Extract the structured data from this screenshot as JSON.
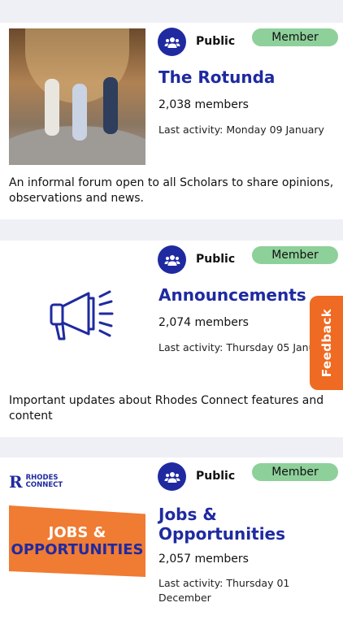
{
  "groups": [
    {
      "privacy": "Public",
      "badge": "Member",
      "title": "The Rotunda",
      "members": "2,038 members",
      "last_activity": "Last activity: Monday 09 January",
      "description": "An informal forum open to all Scholars to share opinions, observations and news.",
      "icon": "group-icon",
      "thumbnail": "rotunda-photo"
    },
    {
      "privacy": "Public",
      "badge": "Member",
      "title": "Announcements",
      "members": "2,074 members",
      "last_activity": "Last activity: Thursday 05 January",
      "description": "Important updates about Rhodes Connect features and content",
      "icon": "group-icon",
      "thumbnail": "megaphone-icon"
    },
    {
      "privacy": "Public",
      "badge": "Member",
      "title": "Jobs & Opportunities",
      "members": "2,057 members",
      "last_activity": "Last activity: Thursday 01 December",
      "icon": "group-icon",
      "thumbnail_text": {
        "logo_line1": "RHODES",
        "logo_line2": "CONNECT",
        "banner_line1": "JOBS &",
        "banner_line2": "OPPORTUNITIES"
      }
    }
  ],
  "feedback": {
    "label": "Feedback"
  },
  "colors": {
    "brand_blue": "#1f2aa0",
    "badge_green": "#8ed09a",
    "feedback_orange": "#ef6a22",
    "jobs_orange": "#f07b33",
    "background": "#eff0f5"
  }
}
